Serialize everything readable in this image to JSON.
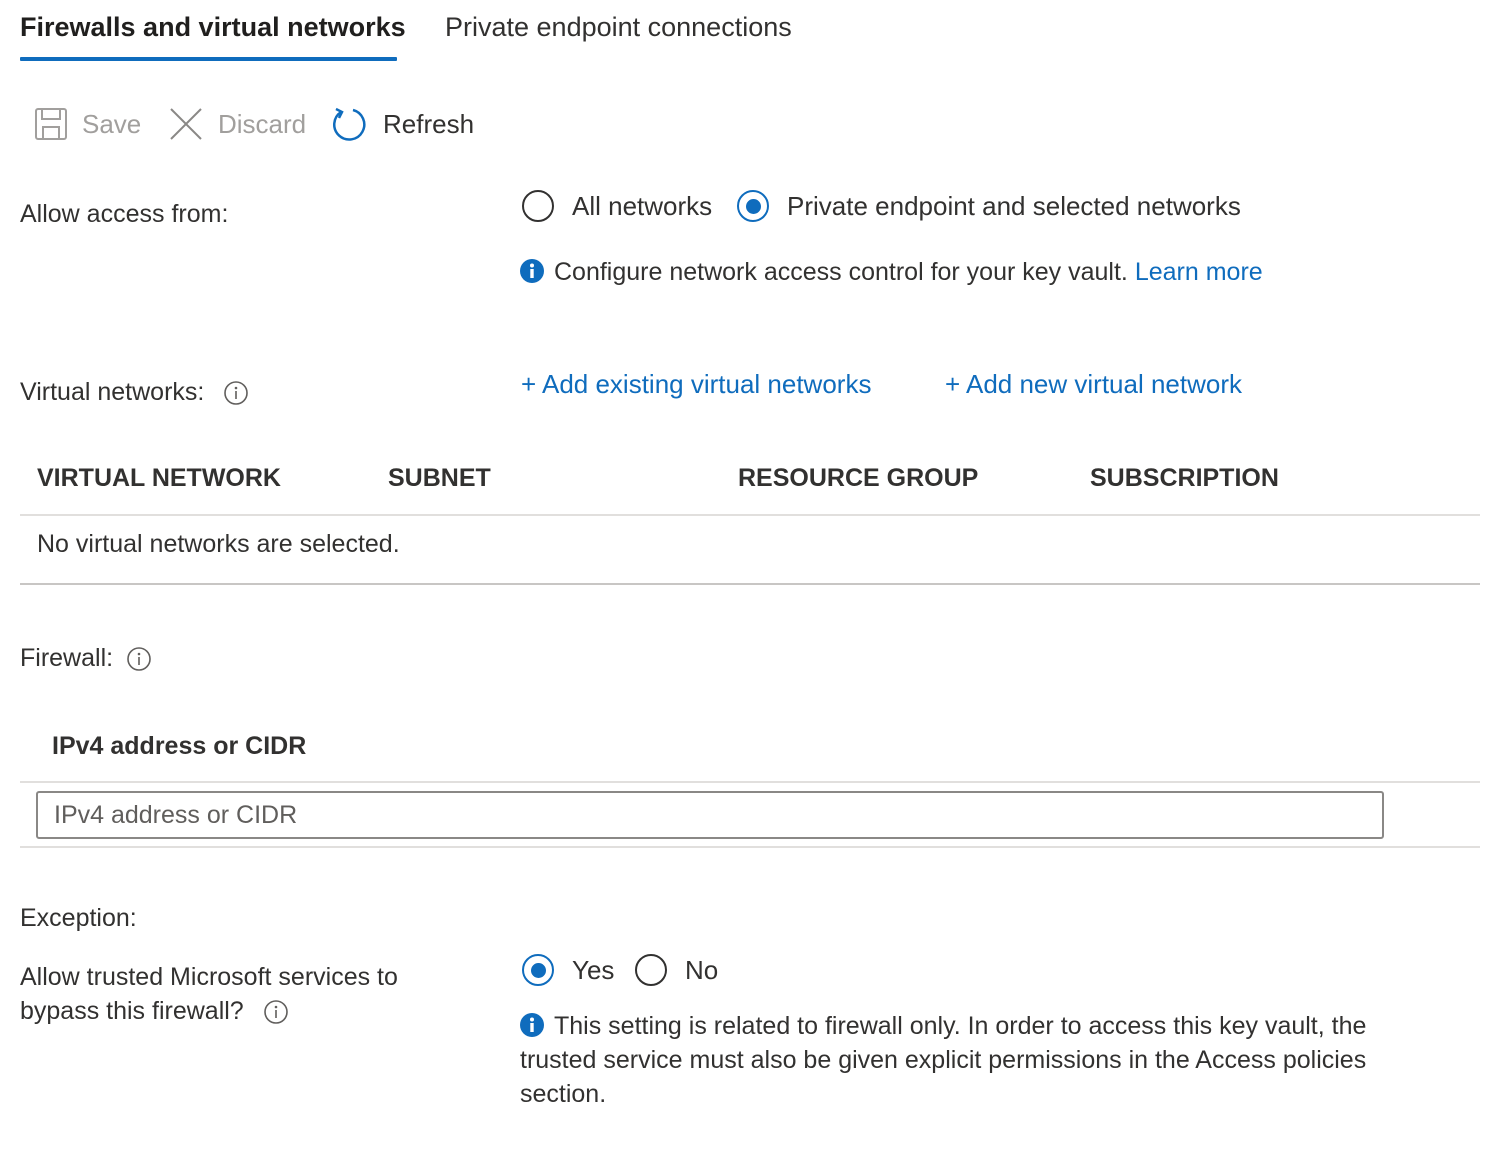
{
  "tabs": [
    {
      "label": "Firewalls and virtual networks",
      "active": true
    },
    {
      "label": "Private endpoint connections",
      "active": false
    }
  ],
  "toolbar": {
    "save_label": "Save",
    "discard_label": "Discard",
    "refresh_label": "Refresh",
    "icons": {
      "save": "save-icon",
      "discard": "close-icon",
      "refresh": "refresh-icon"
    }
  },
  "access": {
    "label": "Allow access from:",
    "options": [
      {
        "label": "All networks",
        "selected": false
      },
      {
        "label": "Private endpoint and selected networks",
        "selected": true
      }
    ],
    "info_text": "Configure network access control for your key vault.",
    "learn_more": "Learn more"
  },
  "virtual_networks": {
    "label": "Virtual networks:",
    "add_existing": "+ Add existing virtual networks",
    "add_new": "+ Add new virtual network",
    "columns": [
      "VIRTUAL NETWORK",
      "SUBNET",
      "RESOURCE GROUP",
      "SUBSCRIPTION"
    ],
    "empty_message": "No virtual networks are selected."
  },
  "firewall": {
    "label": "Firewall:",
    "column_header": "IPv4 address or CIDR",
    "input_placeholder": "IPv4 address or CIDR",
    "input_value": ""
  },
  "exception": {
    "label": "Exception:",
    "question_line1": "Allow trusted Microsoft services to",
    "question_line2": "bypass this firewall?",
    "options": [
      {
        "label": "Yes",
        "selected": true
      },
      {
        "label": "No",
        "selected": false
      }
    ],
    "info_line1": "This setting is related to firewall only. In order to access this key vault, the",
    "info_line2": "trusted service must also be given explicit permissions in the Access policies",
    "info_line3": "section."
  },
  "colors": {
    "accent": "#0f6cbd",
    "text": "#323130",
    "disabled": "#a19f9d",
    "divider": "#e1dfdd"
  }
}
